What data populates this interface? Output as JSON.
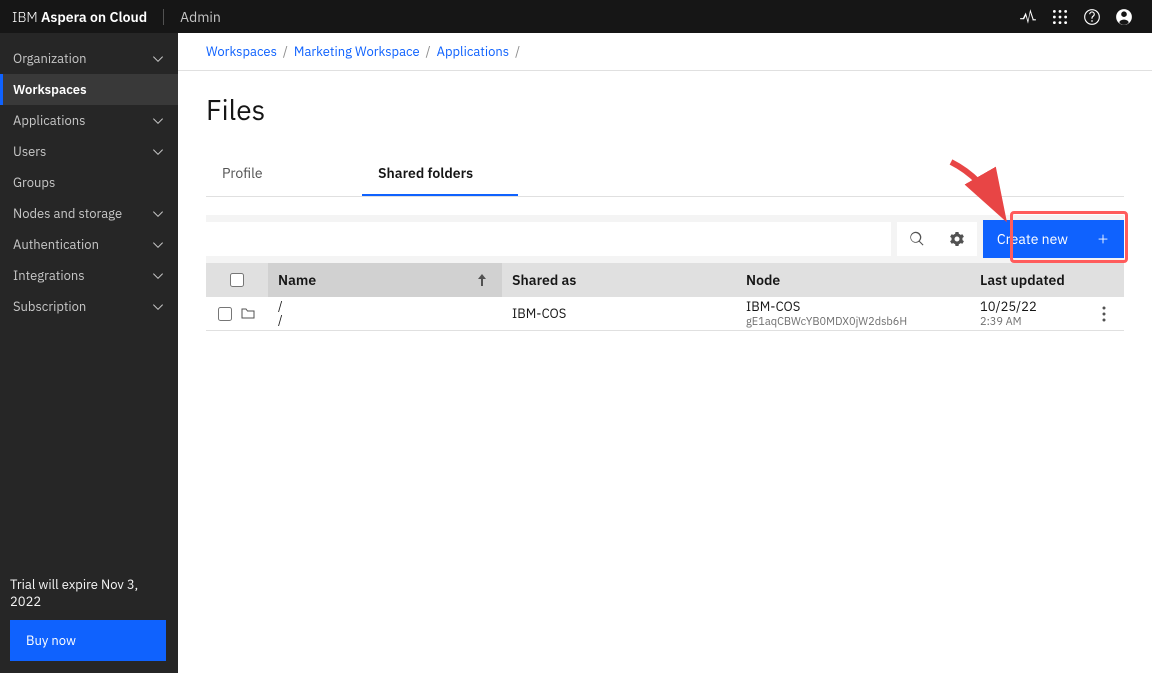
{
  "topbar": {
    "brand_prefix": "IBM ",
    "brand_bold": "Aspera on Cloud",
    "admin_label": "Admin"
  },
  "sidebar": {
    "items": [
      {
        "label": "Organization",
        "expandable": true
      },
      {
        "label": "Workspaces",
        "expandable": false,
        "active": true
      },
      {
        "label": "Applications",
        "expandable": true
      },
      {
        "label": "Users",
        "expandable": true
      },
      {
        "label": "Groups",
        "expandable": false
      },
      {
        "label": "Nodes and storage",
        "expandable": true
      },
      {
        "label": "Authentication",
        "expandable": true
      },
      {
        "label": "Integrations",
        "expandable": true
      },
      {
        "label": "Subscription",
        "expandable": true
      }
    ],
    "trial_text": "Trial will expire Nov 3, 2022",
    "buy_label": "Buy now"
  },
  "breadcrumb": {
    "items": [
      "Workspaces",
      "Marketing Workspace",
      "Applications"
    ],
    "trailing_sep": "/"
  },
  "page": {
    "title": "Files",
    "tabs": [
      "Profile",
      "Shared folders"
    ],
    "active_tab": 1
  },
  "toolbar": {
    "create_label": "Create new"
  },
  "table": {
    "headers": {
      "name": "Name",
      "shared_as": "Shared as",
      "node": "Node",
      "last_updated": "Last updated"
    },
    "rows": [
      {
        "path1": "/",
        "path2": "/",
        "shared_as": "IBM-COS",
        "node_name": "IBM-COS",
        "node_id": "gE1aqCBWcYB0MDX0jW2dsb6H",
        "updated_date": "10/25/22",
        "updated_time": "2:39 AM"
      }
    ]
  }
}
